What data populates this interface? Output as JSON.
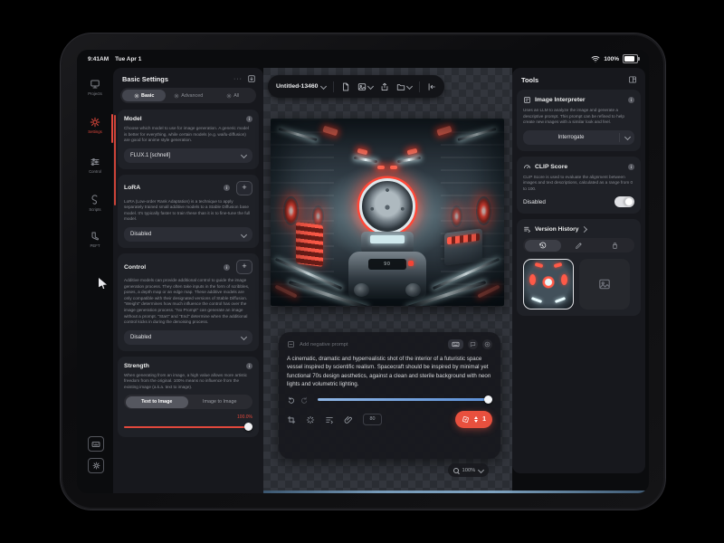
{
  "device": {
    "time": "9:41AM",
    "date": "Tue Apr 1",
    "battery_percent": "100%"
  },
  "sidebar": {
    "items": [
      {
        "label": "Projects",
        "icon": "projects-icon",
        "active": false
      },
      {
        "label": "Settings",
        "icon": "settings-gear-icon",
        "active": true
      },
      {
        "label": "Control",
        "icon": "control-sliders-icon",
        "active": false
      },
      {
        "label": "Scripts",
        "icon": "scripts-icon",
        "active": false
      },
      {
        "label": "PEFT",
        "icon": "peft-icon",
        "active": false
      }
    ]
  },
  "settings_panel": {
    "title": "Basic Settings",
    "menu_dots": "···",
    "tabs": [
      {
        "label": "Basic",
        "active": true
      },
      {
        "label": "Advanced",
        "active": false
      },
      {
        "label": "All",
        "active": false
      }
    ],
    "model": {
      "title": "Model",
      "description": "Choose which model to use for image generation. A generic model is better for everything, while certain models (e.g. waifu-diffusion) are good for anime style generation.",
      "value": "FLUX.1 [schnell]"
    },
    "lora": {
      "title": "LoRA",
      "description": "LoRA (Low-order Rank Adaptation) is a technique to apply separately trained small additive models to a Stable Diffusion base model. It's typically faster to train these than it is to fine-tune the full model.",
      "value": "Disabled"
    },
    "control": {
      "title": "Control",
      "description": "Additive models can provide additional control to guide the image generation process. They often take inputs in the form of scribbles, poses, a depth map or an edge map. These additive models are only compatible with their designated versions of Stable Diffusion. \"Weight\" determines how much influence the control has over the image generation process. \"No Prompt\" can generate an image without a prompt. \"Start\" and \"End\" determine when the additional control kicks in during the denoising process.",
      "value": "Disabled"
    },
    "strength": {
      "title": "Strength",
      "description": "When generating from an image, a high value allows more artistic freedom from the original. 100% means no influence from the existing image (a.k.a. text to image).",
      "segments": [
        {
          "label": "Text to Image",
          "active": true
        },
        {
          "label": "Image to Image",
          "active": false
        }
      ],
      "value_label": "100.0%",
      "percent": 100
    }
  },
  "canvas": {
    "document_title": "Untitled-13460",
    "zoom_label": "100%",
    "prompt_panel": {
      "negative_placeholder": "Add negative prompt",
      "prompt_text": "A cinematic, dramatic and hyperrealistic shot of the interior of a futuristic space vessel inspired by scientific realism. Spacecraft should be inspired by minimal yet functional 70s design aesthetics, against a clean and sterile background with neon lights and volumetric lighting.",
      "steps_badge": "80",
      "batch_count": "1"
    }
  },
  "tools_panel": {
    "title": "Tools",
    "image_interpreter": {
      "title": "Image Interpreter",
      "description": "Uses an LLM to analyze the image and generate a descriptive prompt. This prompt can be refined to help create new images with a similar look and feel.",
      "button_label": "Interrogate"
    },
    "clip_score": {
      "title": "CLIP Score",
      "description": "CLIP Score is used to evaluate the alignment between images and text descriptions, calculated as a range from 0 to 100.",
      "toggle_label": "Disabled",
      "toggle_on": false
    },
    "version_history": {
      "title": "Version History"
    }
  },
  "colors": {
    "accent_red": "#E8503E",
    "slider_blue": "#5B8FD6",
    "panel_bg": "#17181D",
    "card_bg": "#1F2127",
    "screen_bg": "#0B0C0E"
  }
}
